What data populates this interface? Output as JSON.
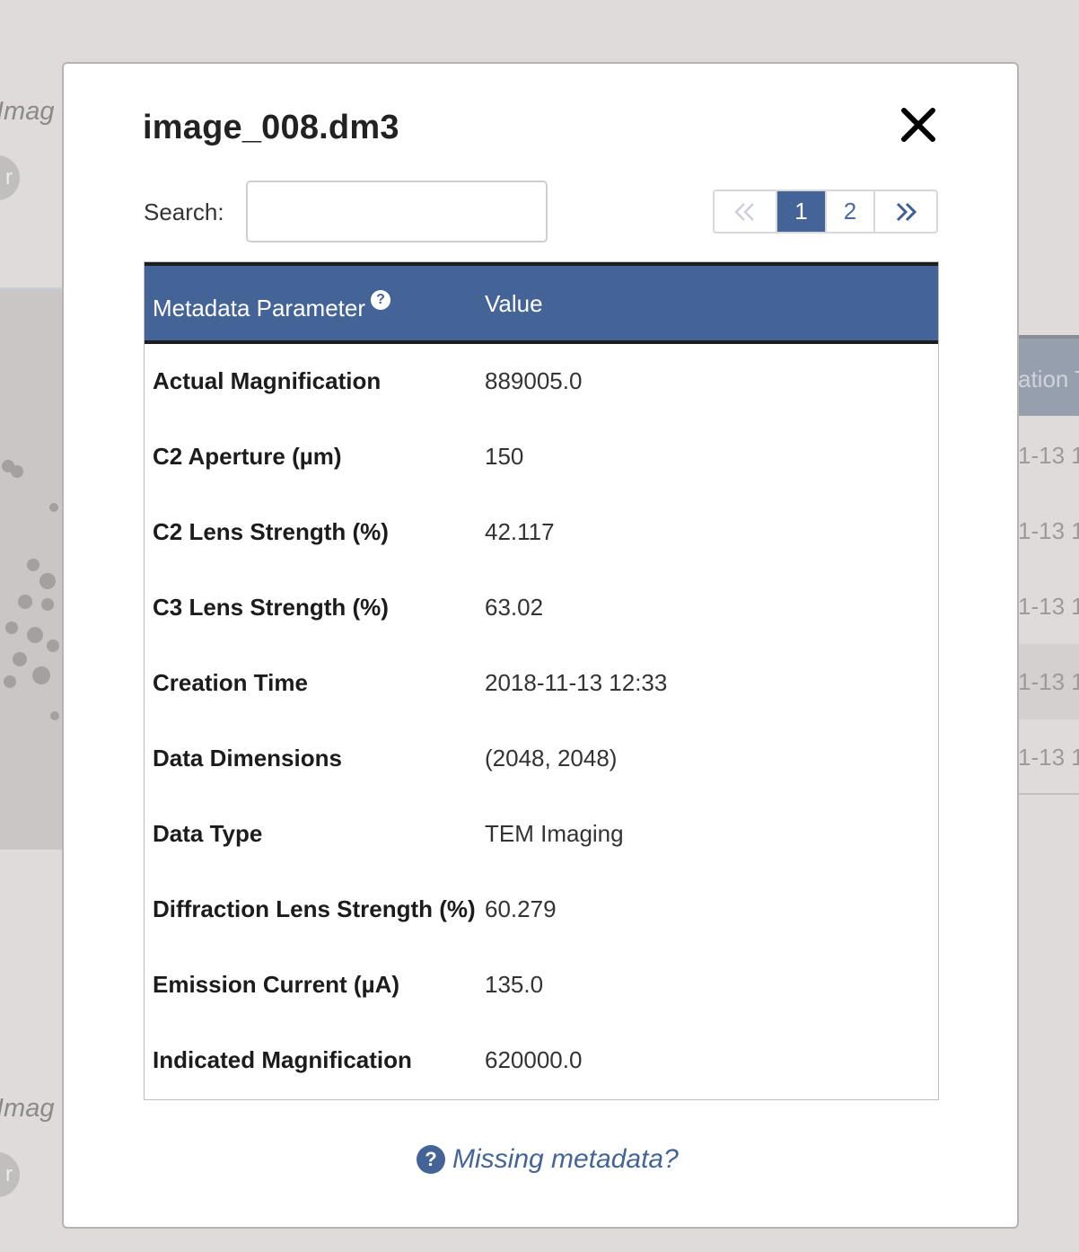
{
  "background": {
    "label_fragment": "Imag",
    "avatar_letter": "r",
    "table_header_fragment": "ation T",
    "cell_fragments": [
      "1-13 1",
      "1-13 1",
      "1-13 1",
      "1-13 1",
      "1-13 1"
    ]
  },
  "modal": {
    "title": "image_008.dm3",
    "search": {
      "label": "Search:",
      "value": "",
      "placeholder": ""
    },
    "pagination": {
      "first_icon": "double-chevron-left-icon",
      "pages": [
        "1",
        "2"
      ],
      "active_page": "1",
      "last_icon": "double-chevron-right-icon"
    },
    "table": {
      "headers": {
        "parameter": "Metadata Parameter",
        "value": "Value",
        "help_glyph": "?"
      },
      "rows": [
        {
          "parameter": "Actual Magnification",
          "value": "889005.0"
        },
        {
          "parameter": "C2 Aperture (µm)",
          "value": "150"
        },
        {
          "parameter": "C2 Lens Strength (%)",
          "value": "42.117"
        },
        {
          "parameter": "C3 Lens Strength (%)",
          "value": "63.02"
        },
        {
          "parameter": "Creation Time",
          "value": "2018-11-13 12:33"
        },
        {
          "parameter": "Data Dimensions",
          "value": "(2048, 2048)"
        },
        {
          "parameter": "Data Type",
          "value": "TEM Imaging"
        },
        {
          "parameter": "Diffraction Lens Strength (%)",
          "value": "60.279"
        },
        {
          "parameter": "Emission Current (µA)",
          "value": "135.0"
        },
        {
          "parameter": "Indicated Magnification",
          "value": "620000.0"
        }
      ]
    },
    "missing_link": {
      "glyph": "?",
      "text": "Missing metadata?"
    }
  },
  "colors": {
    "accent": "#446498",
    "backdrop": "#dedbda",
    "header_border": "#1d1d1d"
  }
}
